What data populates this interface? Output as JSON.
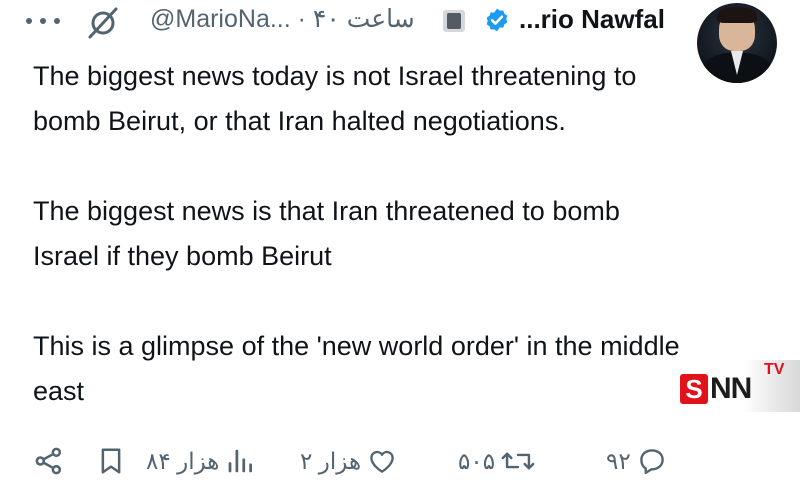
{
  "tweet": {
    "author_name": "...rio Nawfal",
    "meta": "@MarioNa... · ۴۰ ساعت",
    "paragraphs": [
      "The biggest news today is not Israel threatening to bomb Beirut, or that Iran halted negotiations.",
      "The biggest news is that Iran threatened to bomb Israel if they bomb Beirut",
      "This is a glimpse of the 'new world order' in the middle east"
    ]
  },
  "actions": {
    "replies": "۹۲",
    "retweets": "۵۰۵",
    "likes": "۲ هزار",
    "views": "۸۴ هزار"
  },
  "watermark": {
    "s": "S",
    "nn": "NN",
    "tv": "TV"
  },
  "colors": {
    "verified": "#1d9bf0",
    "muted": "#536471",
    "text": "#0f1419",
    "watermark_red": "#e1121b"
  },
  "icons": [
    "more-icon",
    "grok-icon",
    "affiliate-badge-icon",
    "verified-icon",
    "reply-icon",
    "retweet-icon",
    "like-icon",
    "views-icon",
    "bookmark-icon",
    "share-icon"
  ]
}
